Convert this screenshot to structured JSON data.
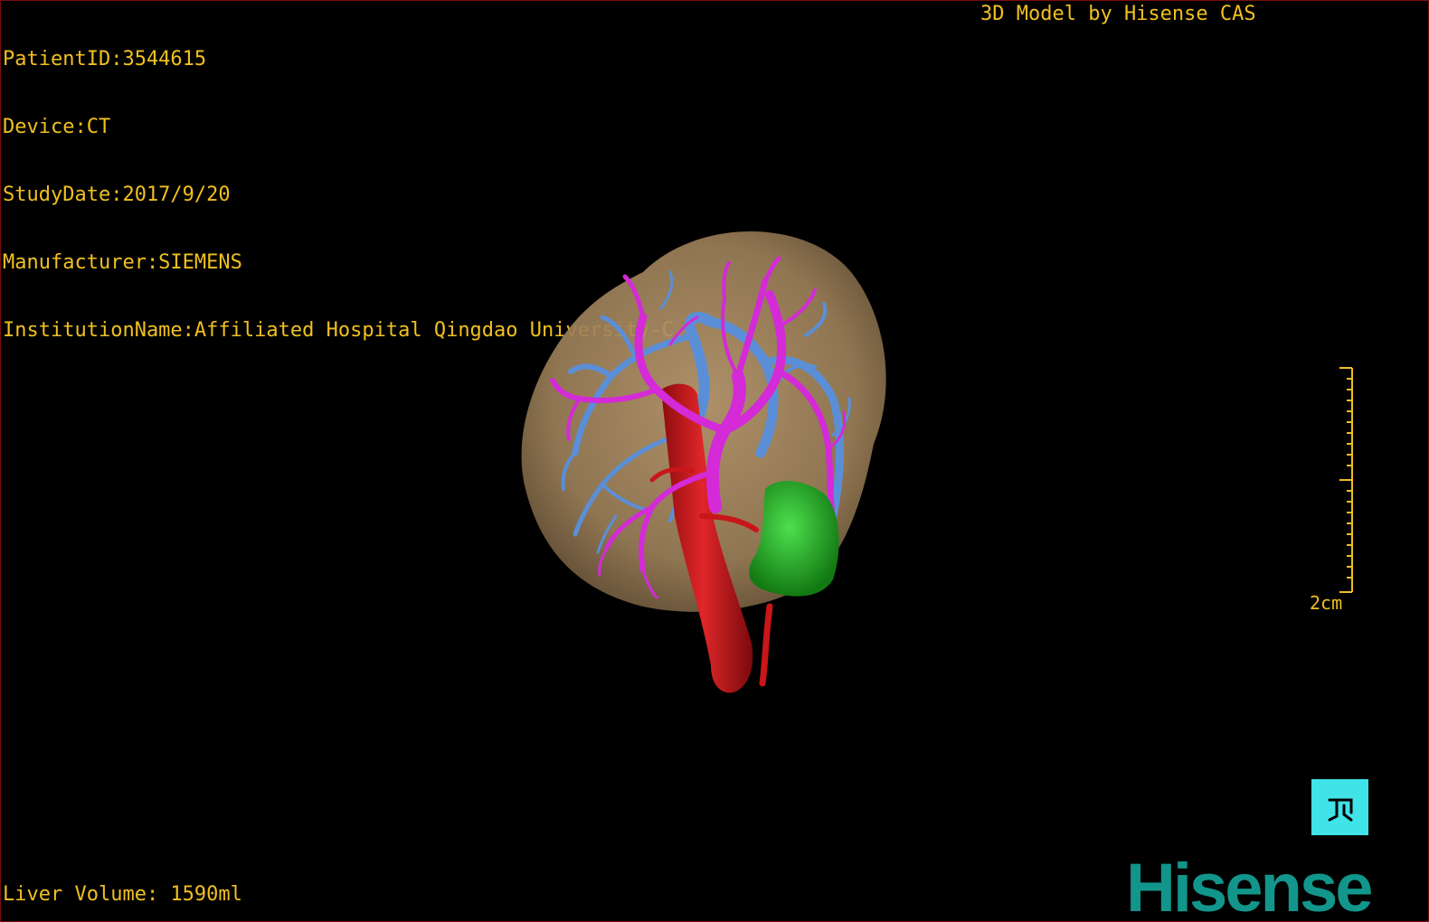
{
  "study": {
    "patient_id": "PatientID:3544615",
    "device": "Device:CT",
    "study_date": "StudyDate:2017/9/20",
    "manufacturer": "Manufacturer:SIEMENS",
    "institution": "InstitutionName:Affiliated Hospital Qingdao University-C"
  },
  "credit": "3D Model by Hisense CAS",
  "liver_volume": "Liver Volume: 1590ml",
  "scale_bar": {
    "label": "2cm"
  },
  "orientation": {
    "icon": "orientation-cube-icon"
  },
  "brand": {
    "logo_text": "Hisense",
    "color": "#12958a"
  },
  "colors": {
    "overlay_text": "#f0c020",
    "liver": "#a08560",
    "artery": "#c8161a",
    "portal_vein": "#d42ad8",
    "hepatic_vein": "#5a8fd8",
    "tumor": "#22b322",
    "orientation_cube": "#3fe3e8"
  }
}
